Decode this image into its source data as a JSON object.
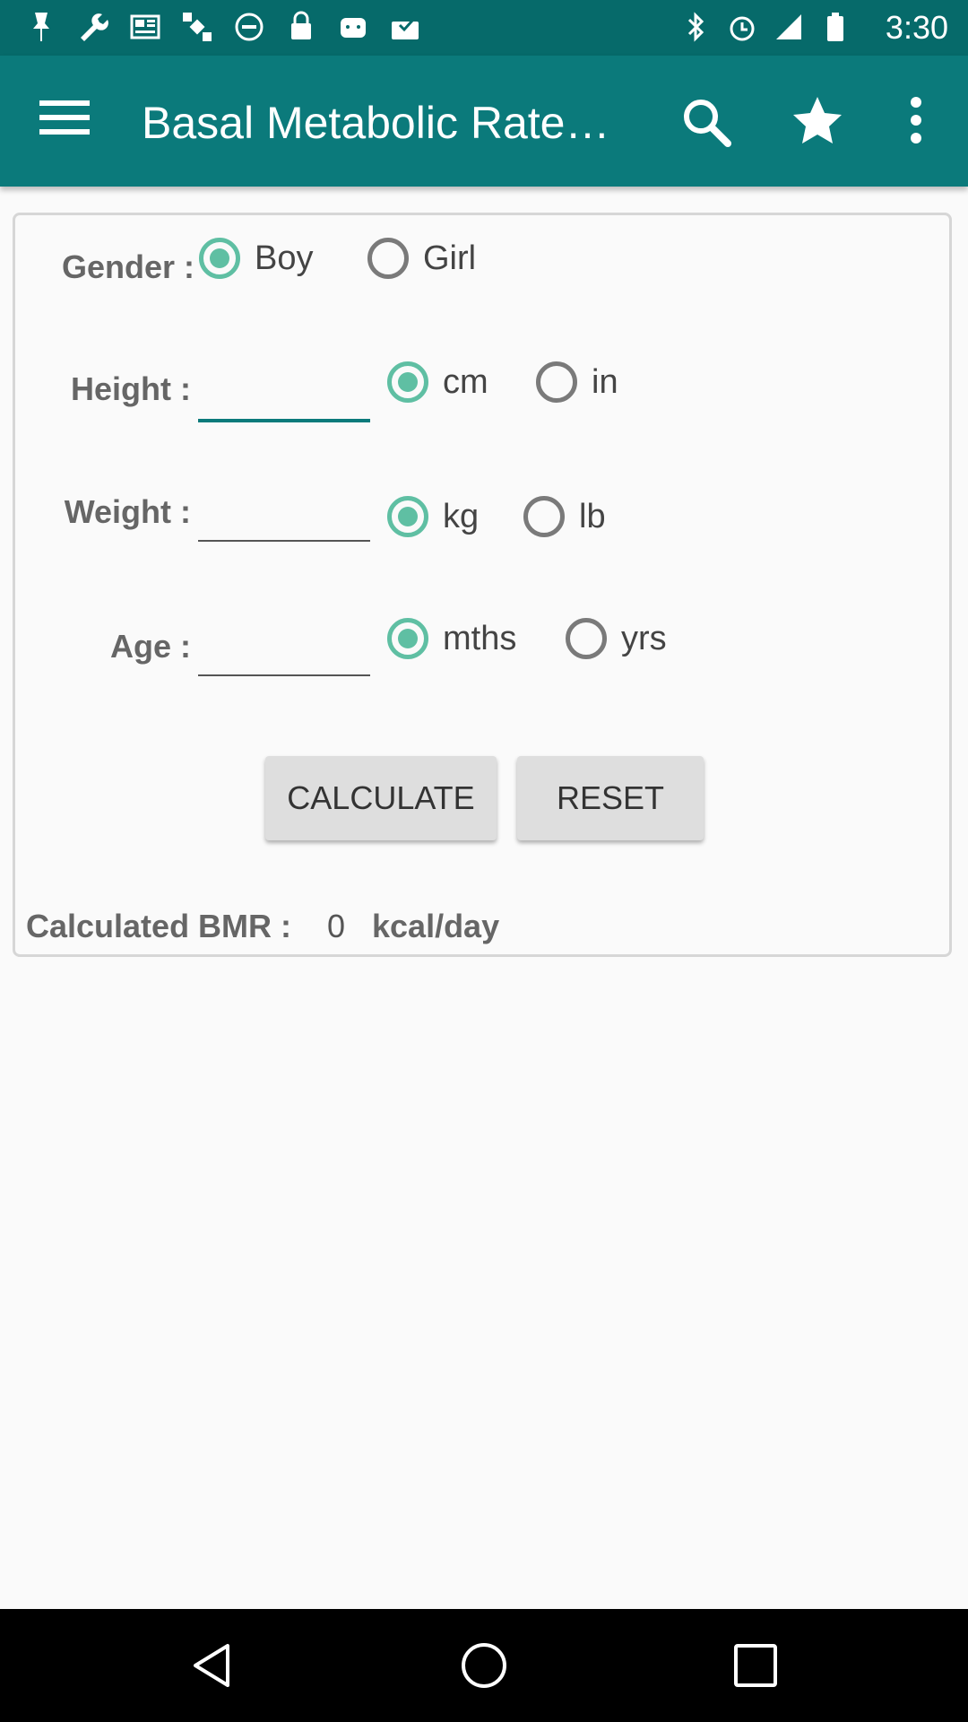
{
  "status_bar": {
    "time": "3:30",
    "left_icons": [
      "pin-icon",
      "wrench-icon",
      "news-icon",
      "satellite-icon",
      "block-icon",
      "lock-icon",
      "android-icon",
      "inbox-check-icon"
    ],
    "right_icons": [
      "bluetooth-icon",
      "alarm-icon",
      "signal-icon",
      "battery-icon"
    ]
  },
  "app_bar": {
    "title": "Basal Metabolic Rate…",
    "color": "#0b7a7b"
  },
  "form": {
    "gender": {
      "label": "Gender :",
      "options": [
        "Boy",
        "Girl"
      ],
      "selected": "Boy"
    },
    "height": {
      "label": "Height :",
      "value": "",
      "units": [
        "cm",
        "in"
      ],
      "selected_unit": "cm"
    },
    "weight": {
      "label": "Weight :",
      "value": "",
      "units": [
        "kg",
        "lb"
      ],
      "selected_unit": "kg"
    },
    "age": {
      "label": "Age :",
      "value": "",
      "units": [
        "mths",
        "yrs"
      ],
      "selected_unit": "mths"
    },
    "calculate_label": "CALCULATE",
    "reset_label": "RESET",
    "result": {
      "label": "Calculated BMR :",
      "value": "0",
      "unit": "kcal/day"
    }
  },
  "accent_color": "#5fbfa3"
}
